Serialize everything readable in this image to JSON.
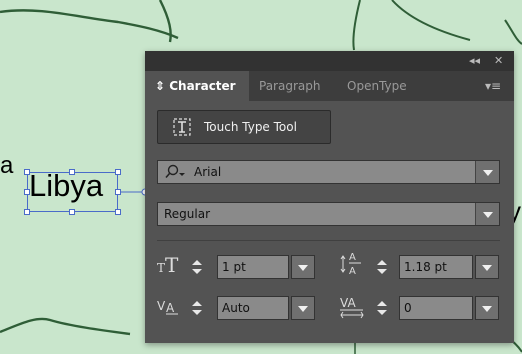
{
  "map": {
    "labels": {
      "libya": "Libya",
      "left_fragment": "a",
      "right_fragment": "y"
    },
    "colors": {
      "land": "#c9e6cc",
      "border": "#2f5e37",
      "selection": "#4a6bc9"
    }
  },
  "panel": {
    "topbar": {
      "collapse_icon": "double-chevron-left-icon",
      "collapse_label": "◂◂",
      "close_label": "✕"
    },
    "tabs": [
      {
        "label": "Character",
        "active": true
      },
      {
        "label": "Paragraph",
        "active": false
      },
      {
        "label": "OpenType",
        "active": false
      }
    ],
    "menu_label": "▾≡",
    "touch_type_tool": {
      "label": "Touch Type Tool",
      "icon": "touch-type-icon"
    },
    "font_family": {
      "value": "Arial",
      "icon": "font-search-icon"
    },
    "font_style": {
      "value": "Regular"
    },
    "font_size": {
      "value": "1 pt",
      "icon": "font-size-icon"
    },
    "leading": {
      "value": "1.18 pt",
      "icon": "leading-icon"
    },
    "kerning": {
      "value": "Auto",
      "icon": "kerning-icon"
    },
    "tracking": {
      "value": "0",
      "icon": "tracking-icon"
    },
    "colors": {
      "panel_bg": "#535353",
      "tab_bar": "#3d3d3d",
      "field_bg": "#8a8a8a"
    }
  }
}
